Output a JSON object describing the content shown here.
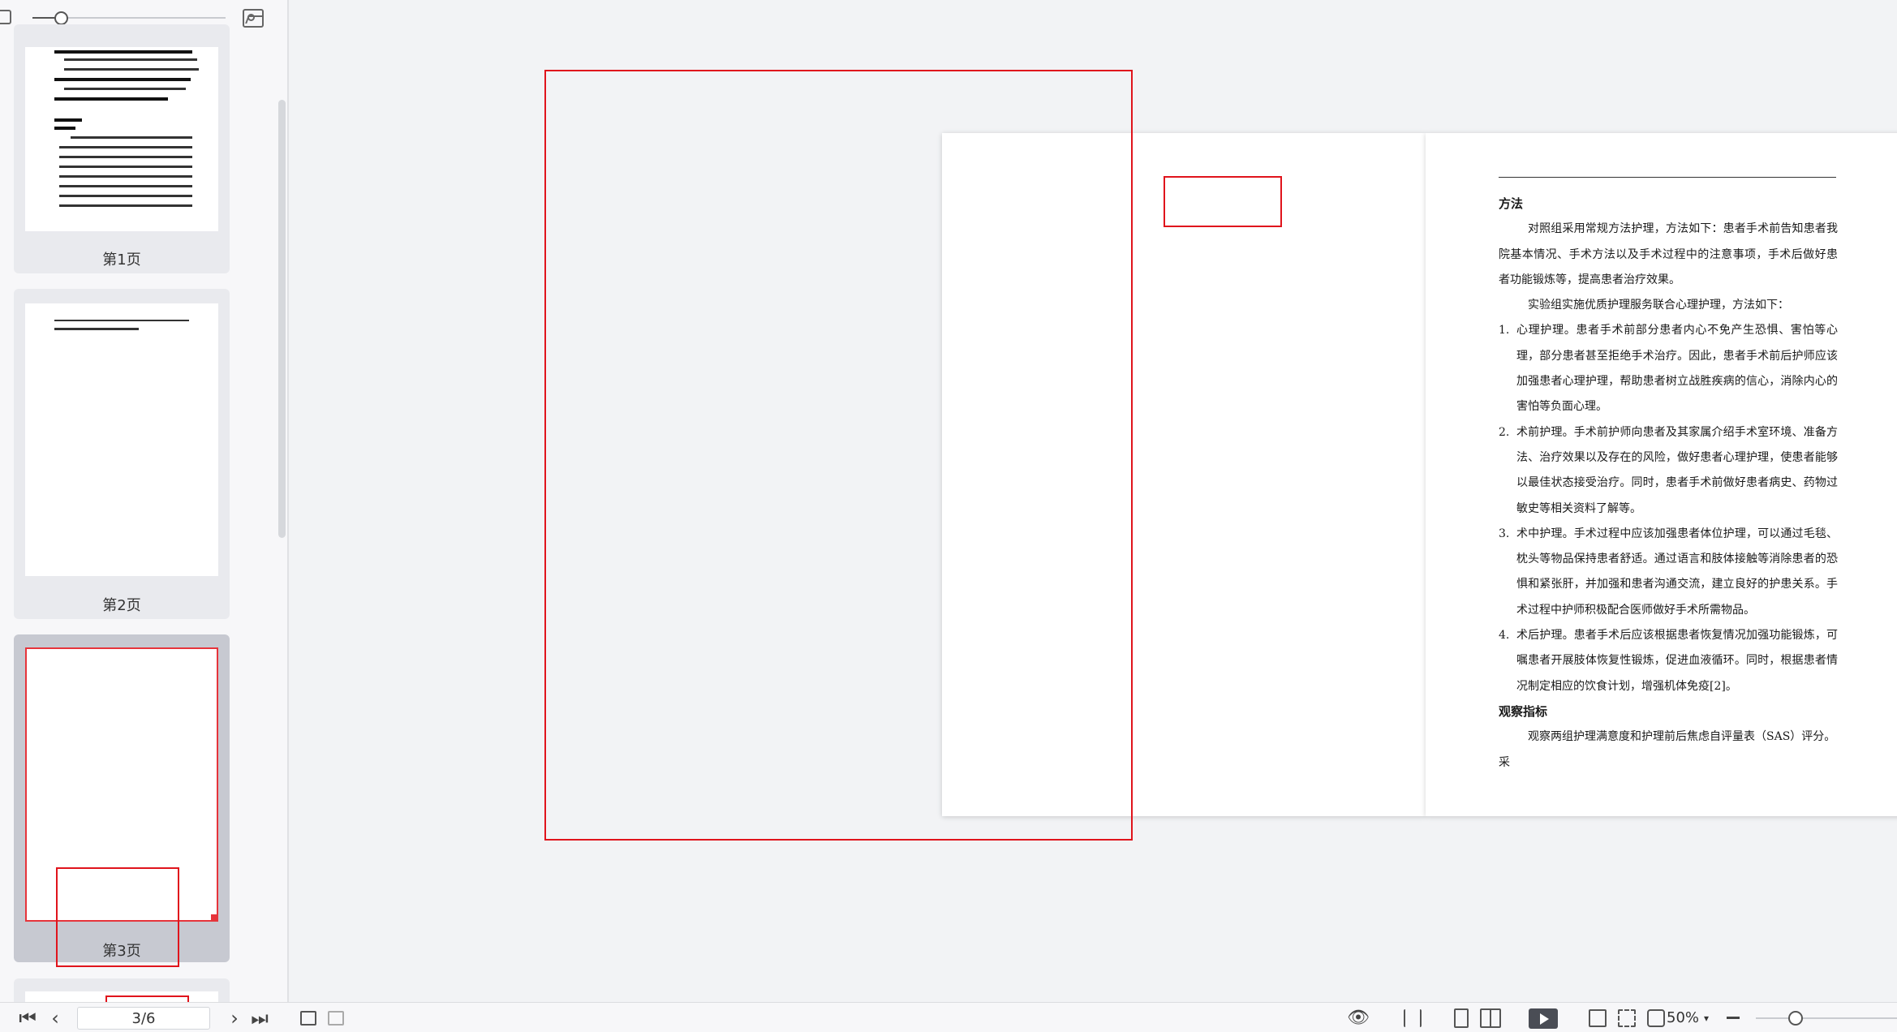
{
  "sidebar": {
    "thumbnails": [
      {
        "label": "第1页",
        "active": false
      },
      {
        "label": "第2页",
        "active": false
      },
      {
        "label": "第3页",
        "active": true
      }
    ],
    "zoom_slider_level": 0.15
  },
  "statusbar": {
    "page_indicator": "3/6",
    "zoom_label": "50%",
    "zoom_slider_level": 0.2,
    "nav": {
      "first_icon": "first-page-icon",
      "prev_icon": "prev-page-icon",
      "next_icon": "next-page-icon",
      "last_icon": "last-page-icon"
    }
  },
  "document": {
    "heading_method": "方法",
    "p1": "对照组采用常规方法护理，方法如下：患者手术前告知患者我院基本情况、手术方法以及手术过程中的注意事项，手术后做好患者功能锻炼等，提高患者治疗效果。",
    "p2": "实验组实施优质护理服务联合心理护理，方法如下：",
    "items": [
      {
        "num": "1.",
        "text": "心理护理。患者手术前部分患者内心不免产生恐惧、害怕等心理，部分患者甚至拒绝手术治疗。因此，患者手术前后护师应该加强患者心理护理，帮助患者树立战胜疾病的信心，消除内心的害怕等负面心理。"
      },
      {
        "num": "2.",
        "text": "术前护理。手术前护师向患者及其家属介绍手术室环境、准备方法、治疗效果以及存在的风险，做好患者心理护理，使患者能够以最佳状态接受治疗。同时，患者手术前做好患者病史、药物过敏史等相关资料了解等。"
      },
      {
        "num": "3.",
        "text": "术中护理。手术过程中应该加强患者体位护理，可以通过毛毯、枕头等物品保持患者舒适。通过语言和肢体接触等消除患者的恐惧和紧张肝，并加强和患者沟通交流，建立良好的护患关系。手术过程中护师积极配合医师做好手术所需物品。"
      },
      {
        "num": "4.",
        "text": "术后护理。患者手术后应该根据患者恢复情况加强功能锻炼，可嘱患者开展肢体恢复性锻炼，促进血液循环。同时，根据患者情况制定相应的饮食计划，增强机体免疫[2]。"
      }
    ],
    "heading_obs": "观察指标",
    "p3": "观察两组护理满意度和护理前后焦虑自评量表（SAS）评分。采"
  },
  "colors": {
    "annotation_red": "#e0141c",
    "active_thumb_bg": "#c7c9d1"
  }
}
